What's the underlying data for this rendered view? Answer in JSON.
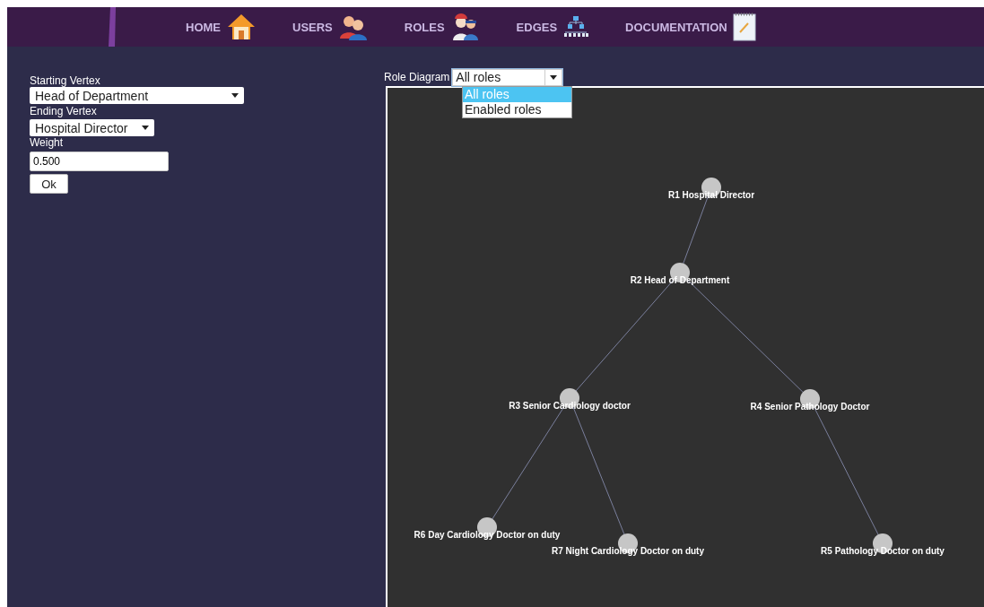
{
  "nav": [
    {
      "label": "HOME",
      "kind": "home"
    },
    {
      "label": "USERS",
      "kind": "users"
    },
    {
      "label": "ROLES",
      "kind": "roles"
    },
    {
      "label": "EDGES",
      "kind": "edges"
    },
    {
      "label": "DOCUMENTATION",
      "kind": "docs"
    }
  ],
  "form": {
    "starting_vertex": {
      "label": "Starting Vertex",
      "value": "Head of Department"
    },
    "ending_vertex": {
      "label": "Ending Vertex",
      "value": "Hospital Director"
    },
    "weight": {
      "label": "Weight",
      "value": "0.500"
    },
    "submit": "Ok"
  },
  "role_diagram": {
    "label": "Role Diagram",
    "value": "All roles",
    "expanded": true,
    "options": [
      {
        "label": "All roles",
        "selected": true
      },
      {
        "label": "Enabled roles",
        "selected": false
      }
    ],
    "tree": {
      "label": "R1 Hospital Director",
      "children": [
        {
          "label": "R2 Head of Department",
          "children": [
            {
              "label": "R3 Senior Cardiology doctor",
              "children": [
                {
                  "label": "R6 Day Cardiology Doctor on duty"
                },
                {
                  "label": "R7 Night Cardiology Doctor on duty"
                }
              ]
            },
            {
              "label": "R4 Senior Pathology Doctor",
              "children": [
                {
                  "label": "R5 Pathology Doctor on duty"
                }
              ]
            }
          ]
        }
      ]
    }
  }
}
